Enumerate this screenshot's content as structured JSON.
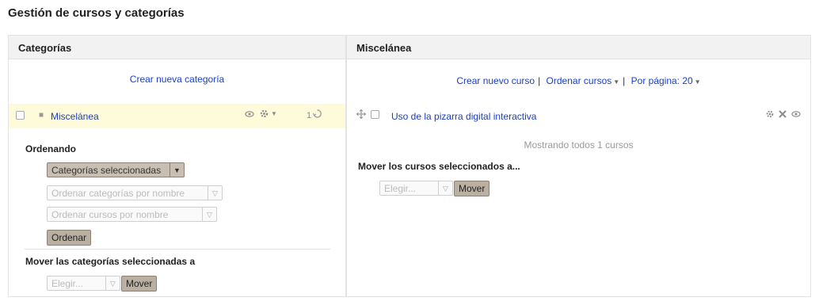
{
  "page_title": "Gestión de cursos y categorías",
  "left": {
    "header": "Categorías",
    "create_link": "Crear nueva categoría",
    "category": {
      "name": "Miscelánea",
      "course_count": "1"
    },
    "sorting": {
      "title": "Ordenando",
      "scope_select": "Categorías seleccionadas",
      "sort_categories_select": "Ordenar categorías por nombre",
      "sort_courses_select": "Ordenar cursos por nombre",
      "sort_button": "Ordenar"
    },
    "move": {
      "title": "Mover las categorías seleccionadas a",
      "choose_placeholder": "Elegir...",
      "move_button": "Mover"
    }
  },
  "right": {
    "header": "Miscelánea",
    "toolbar": {
      "create_course": "Crear nuevo curso",
      "sep1": "|",
      "sort_courses": "Ordenar cursos",
      "sep2": "|",
      "per_page": "Por página: 20"
    },
    "course": {
      "name": "Uso de la pizarra digital interactiva"
    },
    "showing_text": "Mostrando todos 1 cursos",
    "move": {
      "title": "Mover los cursos seleccionados a...",
      "choose_placeholder": "Elegir...",
      "move_button": "Mover"
    }
  },
  "icons": {
    "eye": "eye-icon",
    "gear": "gear-icon",
    "caret": "caret-down-icon",
    "course_count": "course-count-icon",
    "move": "move-icon",
    "delete": "delete-icon"
  }
}
